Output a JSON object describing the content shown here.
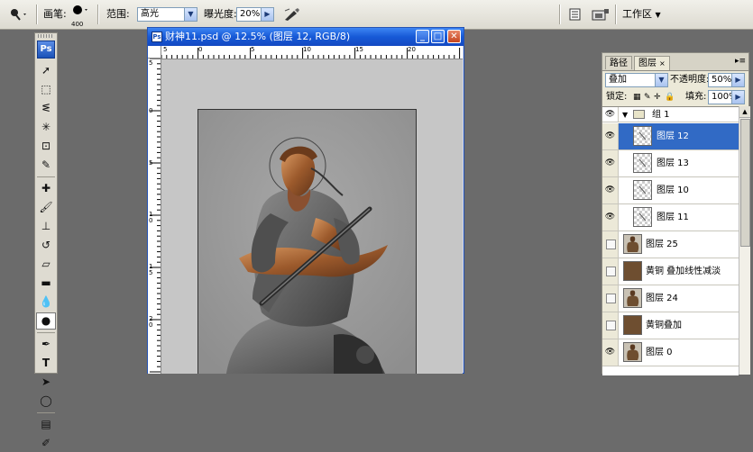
{
  "options": {
    "brush_label": "画笔:",
    "brush_size": "400",
    "range_label": "范围:",
    "range_value": "高光",
    "exposure_label": "曝光度:",
    "exposure_value": "20%",
    "workspace_label": "工作区"
  },
  "document": {
    "title": "财神11.psd @ 12.5% (图层 12, RGB/8)",
    "ruler_top": [
      "5",
      "0",
      "5",
      "10",
      "15",
      "20"
    ],
    "ruler_left": [
      "5",
      "0",
      "5",
      "1 0",
      "1 5",
      "2 0"
    ]
  },
  "layers_panel": {
    "tab_paths": "路径",
    "tab_layers": "图层",
    "tab_close": "×",
    "blend_mode": "叠加",
    "opacity_label": "不透明度:",
    "opacity_value": "50%",
    "lock_label": "锁定:",
    "fill_label": "填充:",
    "fill_value": "100%",
    "group_name": "组 1",
    "layers": [
      {
        "name": "图层 12",
        "visible": true,
        "selected": true,
        "thumb": "transparent"
      },
      {
        "name": "图层 13",
        "visible": true,
        "selected": false,
        "thumb": "transparent"
      },
      {
        "name": "图层 10",
        "visible": true,
        "selected": false,
        "thumb": "transparent"
      },
      {
        "name": "图层 11",
        "visible": true,
        "selected": false,
        "thumb": "transparent"
      },
      {
        "name": "图层 25",
        "visible": false,
        "selected": false,
        "thumb": "figure"
      },
      {
        "name": "黄铜 叠加线性减淡",
        "visible": false,
        "selected": false,
        "thumb": "brown"
      },
      {
        "name": "图层 24",
        "visible": false,
        "selected": false,
        "thumb": "figure"
      },
      {
        "name": "黄铜叠加",
        "visible": false,
        "selected": false,
        "thumb": "brown"
      },
      {
        "name": "图层 0",
        "visible": true,
        "selected": false,
        "thumb": "figure"
      }
    ]
  },
  "colors": {
    "workspace_bg": "#6b6b6b",
    "selection": "#316ac5",
    "titlebar": "#1659d6",
    "bronze": "#a0643a"
  }
}
